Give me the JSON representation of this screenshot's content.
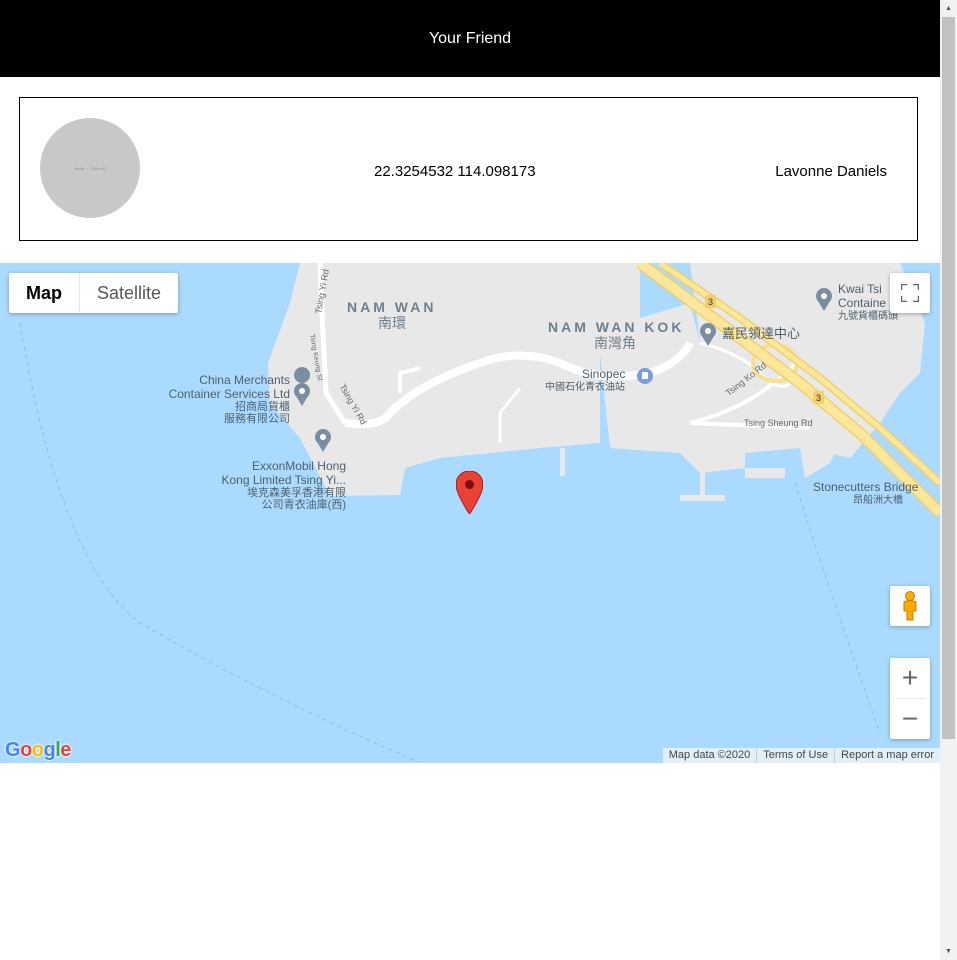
{
  "header": {
    "title": "Your Friend"
  },
  "friend": {
    "avatar_text": "Ninth — 200×40",
    "coordinates": "22.3254532 114.098173",
    "name": "Lavonne Daniels"
  },
  "map": {
    "type_control": {
      "map_label": "Map",
      "satellite_label": "Satellite"
    },
    "labels": {
      "nam_wan": "NAM WAN",
      "nam_wan_zh": "南環",
      "nam_wan_kok": "NAM WAN KOK",
      "nam_wan_kok_zh": "南灣角",
      "china_merchants_1": "China Merchants",
      "china_merchants_2": "Container Services Ltd",
      "china_merchants_zh1": "招商局貨櫃",
      "china_merchants_zh2": "服務有限公司",
      "exxon_1": "ExxonMobil Hong",
      "exxon_2": "Kong Limited Tsing Yi...",
      "exxon_zh1": "埃克森美孚香港有限",
      "exxon_zh2": "公司青衣油庫(西)",
      "sinopec": "Sinopec",
      "sinopec_zh": "中國石化青衣油站",
      "kamen": "嘉民領達中心",
      "kwai_tsing_1": "Kwai Tsi",
      "kwai_tsing_2": "Containe",
      "kwai_tsing_zh": "九號貨櫃碼頭",
      "stonecutters": "Stonecutters Bridge",
      "stonecutters_zh": "昂船洲大橋",
      "tsing_yi_rd_1": "Tsing Yi Rd",
      "tsing_yi_rd_2": "Tsing Yi Rd",
      "tsing_keung_st": "Tsing Keung St",
      "tsing_ko_rd": "Tsing Ko Rd",
      "tsing_sheung_rd": "Tsing Sheung Rd",
      "route_3a": "3",
      "route_3b": "3"
    },
    "google_logo": [
      "G",
      "o",
      "o",
      "g",
      "l",
      "e"
    ],
    "attribution": {
      "map_data": "Map data ©2020",
      "terms": "Terms of Use",
      "report": "Report a map error"
    },
    "zoom_in": "+",
    "zoom_out": "−",
    "colors": {
      "water": "#aadaff",
      "land": "#e8e8e8",
      "highway": "#f8e08e",
      "marker": "#ea4335"
    }
  },
  "scrollbar": {
    "up": "▲",
    "down": "▼"
  }
}
